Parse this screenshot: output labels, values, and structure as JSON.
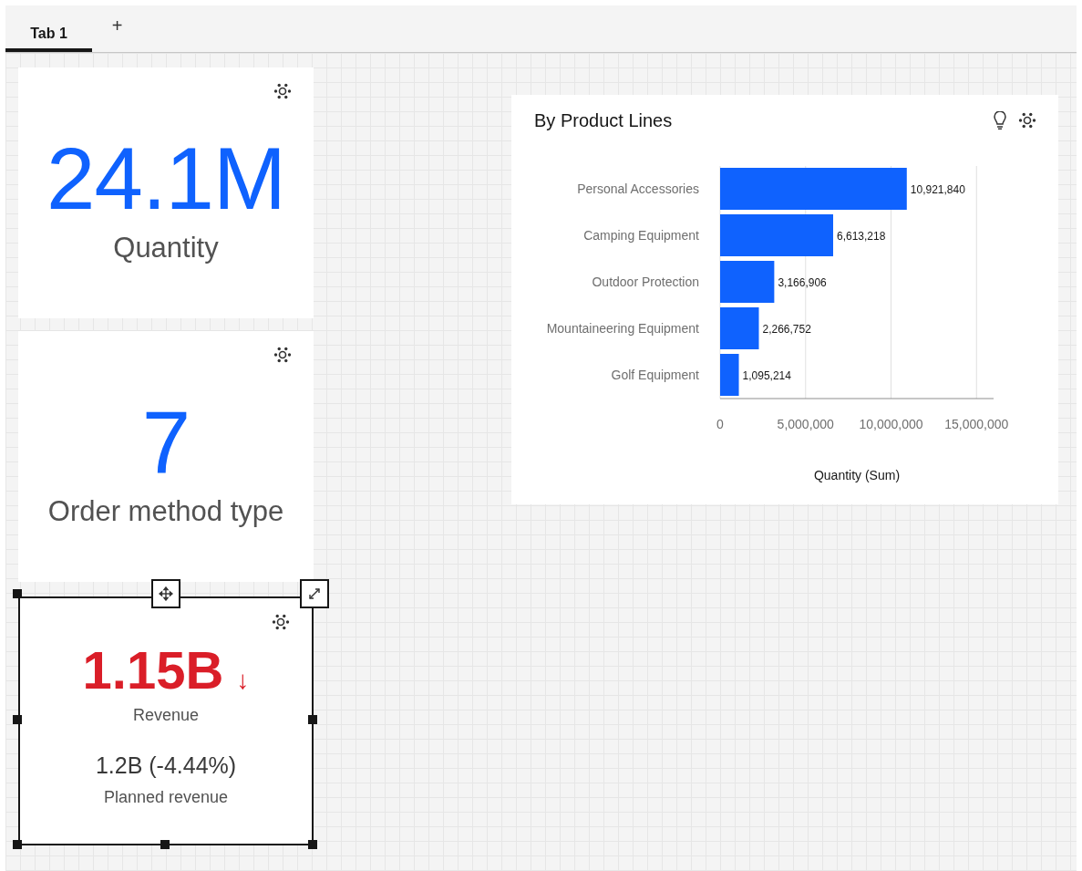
{
  "tabs": [
    {
      "label": "Tab 1",
      "selected": true
    }
  ],
  "add_tab": "+",
  "kpi_cards": [
    {
      "kind": "kpi",
      "value": "24.1M",
      "label": "Quantity",
      "selected": false
    },
    {
      "kind": "kpi",
      "value": "7",
      "label": "Order method type",
      "selected": false
    },
    {
      "kind": "kpi_target",
      "value": "1.15B",
      "trend": "↓",
      "label": "Revenue",
      "target": "1.2B (-4.44%)",
      "target_label": "Planned revenue",
      "selected": true
    }
  ],
  "chart_card": {
    "title": "By Product Lines",
    "chart_data": {
      "type": "bar",
      "orientation": "horizontal",
      "xlabel": "Quantity (Sum)",
      "categories": [
        "Personal Accessories",
        "Camping Equipment",
        "Outdoor Protection",
        "Mountaineering Equipment",
        "Golf Equipment"
      ],
      "series": [
        {
          "color": "#0f62fe",
          "values": [
            10921840,
            6613218,
            3166906,
            2266752,
            1095214
          ]
        }
      ],
      "value_labels": [
        "10,921,840",
        "6,613,218",
        "3,166,906",
        "2,266,752",
        "1,095,214"
      ],
      "grid": true,
      "xlim": [
        0,
        16000000
      ],
      "xticks": [
        {
          "value": 0,
          "label": "0"
        },
        {
          "value": 5000000,
          "label": "5,000,000"
        },
        {
          "value": 10000000,
          "label": "10,000,000"
        },
        {
          "value": 15000000,
          "label": "15,000,000"
        }
      ]
    }
  }
}
